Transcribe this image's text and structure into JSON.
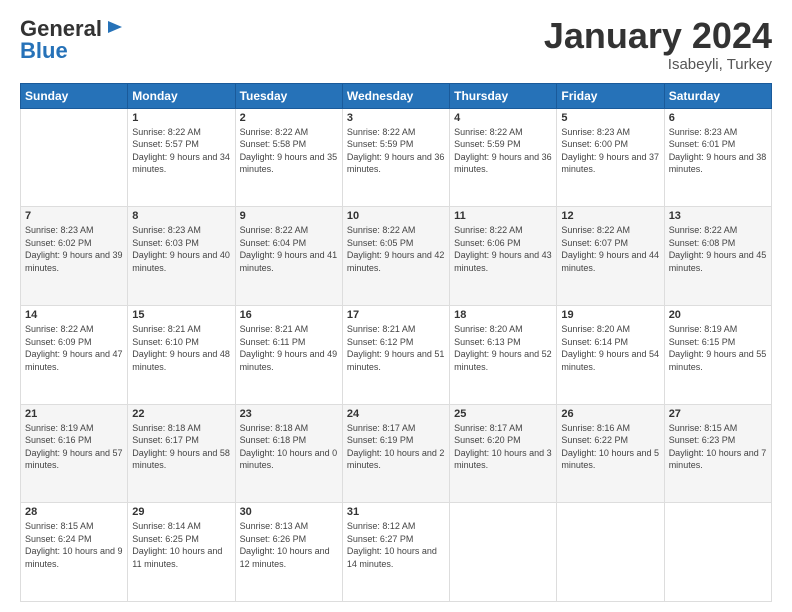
{
  "header": {
    "logo_general": "General",
    "logo_blue": "Blue",
    "month_title": "January 2024",
    "location": "Isabeyli, Turkey"
  },
  "days_of_week": [
    "Sunday",
    "Monday",
    "Tuesday",
    "Wednesday",
    "Thursday",
    "Friday",
    "Saturday"
  ],
  "weeks": [
    [
      {
        "day": "",
        "sunrise": "",
        "sunset": "",
        "daylight": ""
      },
      {
        "day": "1",
        "sunrise": "Sunrise: 8:22 AM",
        "sunset": "Sunset: 5:57 PM",
        "daylight": "Daylight: 9 hours and 34 minutes."
      },
      {
        "day": "2",
        "sunrise": "Sunrise: 8:22 AM",
        "sunset": "Sunset: 5:58 PM",
        "daylight": "Daylight: 9 hours and 35 minutes."
      },
      {
        "day": "3",
        "sunrise": "Sunrise: 8:22 AM",
        "sunset": "Sunset: 5:59 PM",
        "daylight": "Daylight: 9 hours and 36 minutes."
      },
      {
        "day": "4",
        "sunrise": "Sunrise: 8:22 AM",
        "sunset": "Sunset: 5:59 PM",
        "daylight": "Daylight: 9 hours and 36 minutes."
      },
      {
        "day": "5",
        "sunrise": "Sunrise: 8:23 AM",
        "sunset": "Sunset: 6:00 PM",
        "daylight": "Daylight: 9 hours and 37 minutes."
      },
      {
        "day": "6",
        "sunrise": "Sunrise: 8:23 AM",
        "sunset": "Sunset: 6:01 PM",
        "daylight": "Daylight: 9 hours and 38 minutes."
      }
    ],
    [
      {
        "day": "7",
        "sunrise": "Sunrise: 8:23 AM",
        "sunset": "Sunset: 6:02 PM",
        "daylight": "Daylight: 9 hours and 39 minutes."
      },
      {
        "day": "8",
        "sunrise": "Sunrise: 8:23 AM",
        "sunset": "Sunset: 6:03 PM",
        "daylight": "Daylight: 9 hours and 40 minutes."
      },
      {
        "day": "9",
        "sunrise": "Sunrise: 8:22 AM",
        "sunset": "Sunset: 6:04 PM",
        "daylight": "Daylight: 9 hours and 41 minutes."
      },
      {
        "day": "10",
        "sunrise": "Sunrise: 8:22 AM",
        "sunset": "Sunset: 6:05 PM",
        "daylight": "Daylight: 9 hours and 42 minutes."
      },
      {
        "day": "11",
        "sunrise": "Sunrise: 8:22 AM",
        "sunset": "Sunset: 6:06 PM",
        "daylight": "Daylight: 9 hours and 43 minutes."
      },
      {
        "day": "12",
        "sunrise": "Sunrise: 8:22 AM",
        "sunset": "Sunset: 6:07 PM",
        "daylight": "Daylight: 9 hours and 44 minutes."
      },
      {
        "day": "13",
        "sunrise": "Sunrise: 8:22 AM",
        "sunset": "Sunset: 6:08 PM",
        "daylight": "Daylight: 9 hours and 45 minutes."
      }
    ],
    [
      {
        "day": "14",
        "sunrise": "Sunrise: 8:22 AM",
        "sunset": "Sunset: 6:09 PM",
        "daylight": "Daylight: 9 hours and 47 minutes."
      },
      {
        "day": "15",
        "sunrise": "Sunrise: 8:21 AM",
        "sunset": "Sunset: 6:10 PM",
        "daylight": "Daylight: 9 hours and 48 minutes."
      },
      {
        "day": "16",
        "sunrise": "Sunrise: 8:21 AM",
        "sunset": "Sunset: 6:11 PM",
        "daylight": "Daylight: 9 hours and 49 minutes."
      },
      {
        "day": "17",
        "sunrise": "Sunrise: 8:21 AM",
        "sunset": "Sunset: 6:12 PM",
        "daylight": "Daylight: 9 hours and 51 minutes."
      },
      {
        "day": "18",
        "sunrise": "Sunrise: 8:20 AM",
        "sunset": "Sunset: 6:13 PM",
        "daylight": "Daylight: 9 hours and 52 minutes."
      },
      {
        "day": "19",
        "sunrise": "Sunrise: 8:20 AM",
        "sunset": "Sunset: 6:14 PM",
        "daylight": "Daylight: 9 hours and 54 minutes."
      },
      {
        "day": "20",
        "sunrise": "Sunrise: 8:19 AM",
        "sunset": "Sunset: 6:15 PM",
        "daylight": "Daylight: 9 hours and 55 minutes."
      }
    ],
    [
      {
        "day": "21",
        "sunrise": "Sunrise: 8:19 AM",
        "sunset": "Sunset: 6:16 PM",
        "daylight": "Daylight: 9 hours and 57 minutes."
      },
      {
        "day": "22",
        "sunrise": "Sunrise: 8:18 AM",
        "sunset": "Sunset: 6:17 PM",
        "daylight": "Daylight: 9 hours and 58 minutes."
      },
      {
        "day": "23",
        "sunrise": "Sunrise: 8:18 AM",
        "sunset": "Sunset: 6:18 PM",
        "daylight": "Daylight: 10 hours and 0 minutes."
      },
      {
        "day": "24",
        "sunrise": "Sunrise: 8:17 AM",
        "sunset": "Sunset: 6:19 PM",
        "daylight": "Daylight: 10 hours and 2 minutes."
      },
      {
        "day": "25",
        "sunrise": "Sunrise: 8:17 AM",
        "sunset": "Sunset: 6:20 PM",
        "daylight": "Daylight: 10 hours and 3 minutes."
      },
      {
        "day": "26",
        "sunrise": "Sunrise: 8:16 AM",
        "sunset": "Sunset: 6:22 PM",
        "daylight": "Daylight: 10 hours and 5 minutes."
      },
      {
        "day": "27",
        "sunrise": "Sunrise: 8:15 AM",
        "sunset": "Sunset: 6:23 PM",
        "daylight": "Daylight: 10 hours and 7 minutes."
      }
    ],
    [
      {
        "day": "28",
        "sunrise": "Sunrise: 8:15 AM",
        "sunset": "Sunset: 6:24 PM",
        "daylight": "Daylight: 10 hours and 9 minutes."
      },
      {
        "day": "29",
        "sunrise": "Sunrise: 8:14 AM",
        "sunset": "Sunset: 6:25 PM",
        "daylight": "Daylight: 10 hours and 11 minutes."
      },
      {
        "day": "30",
        "sunrise": "Sunrise: 8:13 AM",
        "sunset": "Sunset: 6:26 PM",
        "daylight": "Daylight: 10 hours and 12 minutes."
      },
      {
        "day": "31",
        "sunrise": "Sunrise: 8:12 AM",
        "sunset": "Sunset: 6:27 PM",
        "daylight": "Daylight: 10 hours and 14 minutes."
      },
      {
        "day": "",
        "sunrise": "",
        "sunset": "",
        "daylight": ""
      },
      {
        "day": "",
        "sunrise": "",
        "sunset": "",
        "daylight": ""
      },
      {
        "day": "",
        "sunrise": "",
        "sunset": "",
        "daylight": ""
      }
    ]
  ]
}
